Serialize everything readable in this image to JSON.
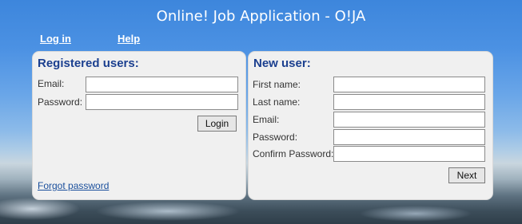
{
  "header": {
    "title": "Online! Job Application - O!JA"
  },
  "nav": {
    "login": "Log in",
    "help": "Help"
  },
  "registered": {
    "heading": "Registered users:",
    "email_label": "Email:",
    "email_value": "",
    "password_label": "Password:",
    "password_value": "",
    "login_button": "Login",
    "forgot_link": "Forgot password"
  },
  "new_user": {
    "heading": "New user:",
    "first_name_label": "First name:",
    "last_name_label": "Last name:",
    "email_label": "Email:",
    "password_label": "Password:",
    "confirm_password_label": "Confirm Password:",
    "next_button": "Next"
  },
  "colors": {
    "heading": "#1b3f8f",
    "link": "#1a4f9c",
    "panel": "#f0f0f0"
  }
}
